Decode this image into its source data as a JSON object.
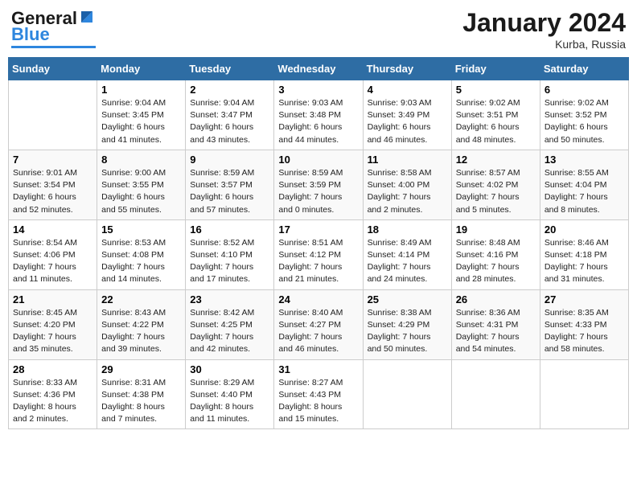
{
  "header": {
    "logo_line1": "General",
    "logo_line2": "Blue",
    "month_title": "January 2024",
    "location": "Kurba, Russia"
  },
  "days_of_week": [
    "Sunday",
    "Monday",
    "Tuesday",
    "Wednesday",
    "Thursday",
    "Friday",
    "Saturday"
  ],
  "weeks": [
    [
      {
        "day": "",
        "info": ""
      },
      {
        "day": "1",
        "info": "Sunrise: 9:04 AM\nSunset: 3:45 PM\nDaylight: 6 hours\nand 41 minutes."
      },
      {
        "day": "2",
        "info": "Sunrise: 9:04 AM\nSunset: 3:47 PM\nDaylight: 6 hours\nand 43 minutes."
      },
      {
        "day": "3",
        "info": "Sunrise: 9:03 AM\nSunset: 3:48 PM\nDaylight: 6 hours\nand 44 minutes."
      },
      {
        "day": "4",
        "info": "Sunrise: 9:03 AM\nSunset: 3:49 PM\nDaylight: 6 hours\nand 46 minutes."
      },
      {
        "day": "5",
        "info": "Sunrise: 9:02 AM\nSunset: 3:51 PM\nDaylight: 6 hours\nand 48 minutes."
      },
      {
        "day": "6",
        "info": "Sunrise: 9:02 AM\nSunset: 3:52 PM\nDaylight: 6 hours\nand 50 minutes."
      }
    ],
    [
      {
        "day": "7",
        "info": "Sunrise: 9:01 AM\nSunset: 3:54 PM\nDaylight: 6 hours\nand 52 minutes."
      },
      {
        "day": "8",
        "info": "Sunrise: 9:00 AM\nSunset: 3:55 PM\nDaylight: 6 hours\nand 55 minutes."
      },
      {
        "day": "9",
        "info": "Sunrise: 8:59 AM\nSunset: 3:57 PM\nDaylight: 6 hours\nand 57 minutes."
      },
      {
        "day": "10",
        "info": "Sunrise: 8:59 AM\nSunset: 3:59 PM\nDaylight: 7 hours\nand 0 minutes."
      },
      {
        "day": "11",
        "info": "Sunrise: 8:58 AM\nSunset: 4:00 PM\nDaylight: 7 hours\nand 2 minutes."
      },
      {
        "day": "12",
        "info": "Sunrise: 8:57 AM\nSunset: 4:02 PM\nDaylight: 7 hours\nand 5 minutes."
      },
      {
        "day": "13",
        "info": "Sunrise: 8:55 AM\nSunset: 4:04 PM\nDaylight: 7 hours\nand 8 minutes."
      }
    ],
    [
      {
        "day": "14",
        "info": "Sunrise: 8:54 AM\nSunset: 4:06 PM\nDaylight: 7 hours\nand 11 minutes."
      },
      {
        "day": "15",
        "info": "Sunrise: 8:53 AM\nSunset: 4:08 PM\nDaylight: 7 hours\nand 14 minutes."
      },
      {
        "day": "16",
        "info": "Sunrise: 8:52 AM\nSunset: 4:10 PM\nDaylight: 7 hours\nand 17 minutes."
      },
      {
        "day": "17",
        "info": "Sunrise: 8:51 AM\nSunset: 4:12 PM\nDaylight: 7 hours\nand 21 minutes."
      },
      {
        "day": "18",
        "info": "Sunrise: 8:49 AM\nSunset: 4:14 PM\nDaylight: 7 hours\nand 24 minutes."
      },
      {
        "day": "19",
        "info": "Sunrise: 8:48 AM\nSunset: 4:16 PM\nDaylight: 7 hours\nand 28 minutes."
      },
      {
        "day": "20",
        "info": "Sunrise: 8:46 AM\nSunset: 4:18 PM\nDaylight: 7 hours\nand 31 minutes."
      }
    ],
    [
      {
        "day": "21",
        "info": "Sunrise: 8:45 AM\nSunset: 4:20 PM\nDaylight: 7 hours\nand 35 minutes."
      },
      {
        "day": "22",
        "info": "Sunrise: 8:43 AM\nSunset: 4:22 PM\nDaylight: 7 hours\nand 39 minutes."
      },
      {
        "day": "23",
        "info": "Sunrise: 8:42 AM\nSunset: 4:25 PM\nDaylight: 7 hours\nand 42 minutes."
      },
      {
        "day": "24",
        "info": "Sunrise: 8:40 AM\nSunset: 4:27 PM\nDaylight: 7 hours\nand 46 minutes."
      },
      {
        "day": "25",
        "info": "Sunrise: 8:38 AM\nSunset: 4:29 PM\nDaylight: 7 hours\nand 50 minutes."
      },
      {
        "day": "26",
        "info": "Sunrise: 8:36 AM\nSunset: 4:31 PM\nDaylight: 7 hours\nand 54 minutes."
      },
      {
        "day": "27",
        "info": "Sunrise: 8:35 AM\nSunset: 4:33 PM\nDaylight: 7 hours\nand 58 minutes."
      }
    ],
    [
      {
        "day": "28",
        "info": "Sunrise: 8:33 AM\nSunset: 4:36 PM\nDaylight: 8 hours\nand 2 minutes."
      },
      {
        "day": "29",
        "info": "Sunrise: 8:31 AM\nSunset: 4:38 PM\nDaylight: 8 hours\nand 7 minutes."
      },
      {
        "day": "30",
        "info": "Sunrise: 8:29 AM\nSunset: 4:40 PM\nDaylight: 8 hours\nand 11 minutes."
      },
      {
        "day": "31",
        "info": "Sunrise: 8:27 AM\nSunset: 4:43 PM\nDaylight: 8 hours\nand 15 minutes."
      },
      {
        "day": "",
        "info": ""
      },
      {
        "day": "",
        "info": ""
      },
      {
        "day": "",
        "info": ""
      }
    ]
  ]
}
